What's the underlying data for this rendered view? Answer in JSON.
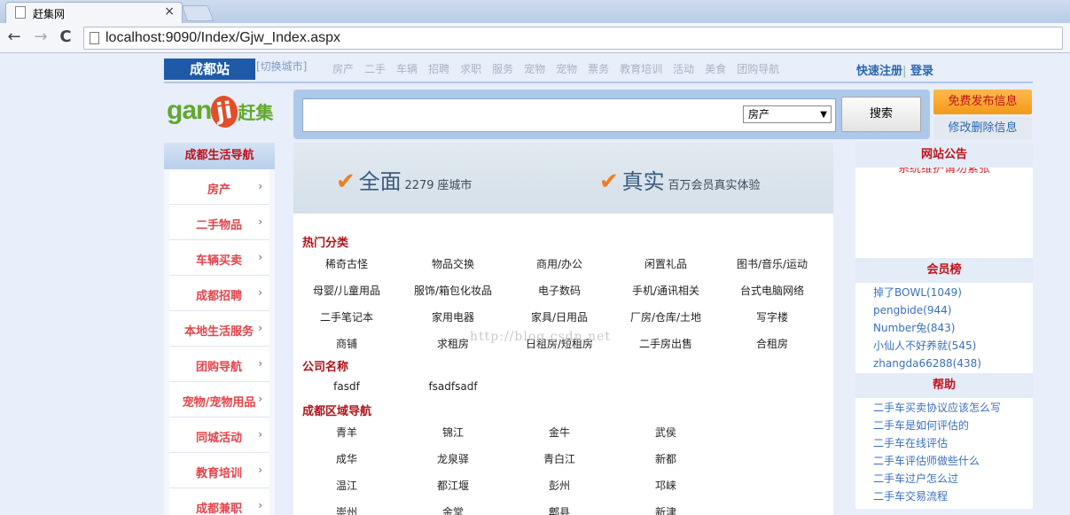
{
  "browser": {
    "tab_title": "赶集网",
    "close_glyph": "×",
    "url": "localhost:9090/Index/Gjw_Index.aspx",
    "back": "←",
    "forward": "→",
    "reload": "C"
  },
  "header": {
    "city": "成都站",
    "switch_city": "[切换城市]",
    "nav": [
      "房产",
      "二手",
      "车辆",
      "招聘",
      "求职",
      "服务",
      "宠物",
      "宠物",
      "票务",
      "教育培训",
      "活动",
      "美食",
      "团购导航"
    ],
    "register": "快速注册",
    "separator": "|",
    "login": "登录"
  },
  "logo": {
    "gan": "gan",
    "ji": "ji",
    "cn": "赶集"
  },
  "search": {
    "value": "",
    "category": "房产",
    "button": "搜索"
  },
  "actions": {
    "free_post": "免费发布信息",
    "edit_post": "修改删除信息"
  },
  "leftnav": {
    "title": "成都生活导航",
    "chevron": "›",
    "items": [
      "房产",
      "二手物品",
      "车辆买卖",
      "成都招聘",
      "本地生活服务",
      "团购导航",
      "宠物/宠物用品",
      "同城活动",
      "教育培训",
      "成都兼职"
    ]
  },
  "banner": {
    "left_big": "全面",
    "left_num": "2279",
    "left_small": "座城市",
    "right_big": "真实",
    "right_small": "百万会员真实体验",
    "check": "✔"
  },
  "hot": {
    "title": "热门分类",
    "rows": [
      [
        "稀奇古怪",
        "物品交换",
        "商用/办公",
        "闲置礼品",
        "图书/音乐/运动"
      ],
      [
        "母婴/儿童用品",
        "服饰/箱包化妆品",
        "电子数码",
        "手机/通讯相关",
        "台式电脑网络"
      ],
      [
        "二手笔记本",
        "家用电器",
        "家具/日用品",
        "厂房/仓库/土地",
        "写字楼"
      ],
      [
        "商铺",
        "求租房",
        "日租房/短租房",
        "二手房出售",
        "合租房"
      ]
    ]
  },
  "company": {
    "title": "公司名称",
    "items": [
      "fasdf",
      "fsadfsadf"
    ]
  },
  "region": {
    "title": "成都区域导航",
    "rows": [
      [
        "青羊",
        "锦江",
        "金牛",
        "武侯"
      ],
      [
        "成华",
        "龙泉驿",
        "青白江",
        "新都"
      ],
      [
        "温江",
        "都江堰",
        "彭州",
        "邛崃"
      ],
      [
        "崇州",
        "金堂",
        "郫县",
        "新津"
      ]
    ]
  },
  "watermark": "http://blog.csdn.net",
  "notice": {
    "title": "网站公告",
    "text": "系统维护请勿紧张"
  },
  "members": {
    "title": "会员榜",
    "items": [
      "掉了BOWL(1049)",
      "pengbide(944)",
      "Number兔(843)",
      "小仙人不好养就(545)",
      "zhangda66288(438)"
    ]
  },
  "help": {
    "title": "帮助",
    "items": [
      "二手车买卖协议应该怎么写",
      "二手车是如何评估的",
      "二手车在线评估",
      "二手车评估师做些什么",
      "二手车过户怎么过",
      "二手车交易流程"
    ]
  }
}
